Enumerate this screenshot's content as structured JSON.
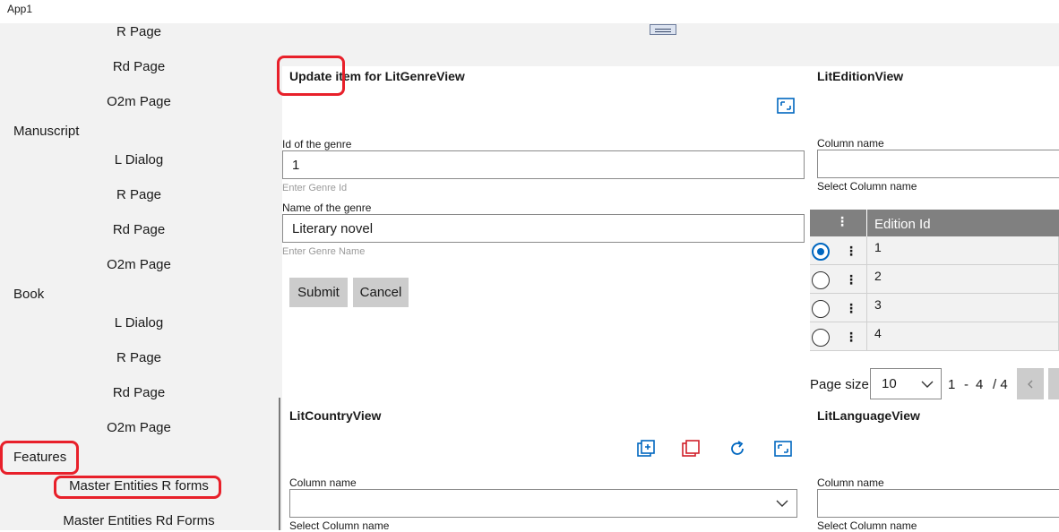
{
  "app": {
    "title": "App1"
  },
  "sidebar": {
    "items": [
      {
        "label": "R Page",
        "level": 2
      },
      {
        "label": "Rd Page",
        "level": 2
      },
      {
        "label": "O2m Page",
        "level": 2
      },
      {
        "label": "Manuscript",
        "level": 1
      },
      {
        "label": "L Dialog",
        "level": 2
      },
      {
        "label": "R Page",
        "level": 2
      },
      {
        "label": "Rd Page",
        "level": 2
      },
      {
        "label": "O2m Page",
        "level": 2
      },
      {
        "label": "Book",
        "level": 1
      },
      {
        "label": "L Dialog",
        "level": 2
      },
      {
        "label": "R Page",
        "level": 2
      },
      {
        "label": "Rd Page",
        "level": 2
      },
      {
        "label": "O2m Page",
        "level": 2
      },
      {
        "label": "Features",
        "level": 1
      },
      {
        "label": "Master Entities R forms",
        "level": 2
      },
      {
        "label": "Master Entities Rd Forms",
        "level": 2
      }
    ]
  },
  "genre_form": {
    "title": "Update item for LitGenreView",
    "id_label": "Id of the genre",
    "id_value": "1",
    "id_hint": "Enter Genre Id",
    "name_label": "Name of the genre",
    "name_value": "Literary novel",
    "name_hint": "Enter Genre Name",
    "submit_label": "Submit",
    "cancel_label": "Cancel"
  },
  "edition_view": {
    "title": "LitEditionView",
    "column_label": "Column name",
    "column_value": "",
    "column_hint": "Select Column name",
    "grid_header": "Edition Id",
    "rows": [
      "1",
      "2",
      "3",
      "4"
    ],
    "selected_row": 0,
    "page_size_label": "Page size",
    "page_size_value": "10",
    "range_start": "1",
    "range_sep": "-",
    "range_end": "4",
    "total": "/ 4"
  },
  "country_view": {
    "title": "LitCountryView",
    "column_label": "Column name",
    "column_value": "",
    "column_hint": "Select Column name"
  },
  "language_view": {
    "title": "LitLanguageView",
    "column_label": "Column name",
    "column_value": "",
    "column_hint": "Select Column name"
  },
  "colors": {
    "accent": "#0067c0",
    "danger": "#d0202a",
    "annotation": "#e8202a",
    "sidebar_bg": "#f2f2f2",
    "grid_header_bg": "#808080"
  }
}
